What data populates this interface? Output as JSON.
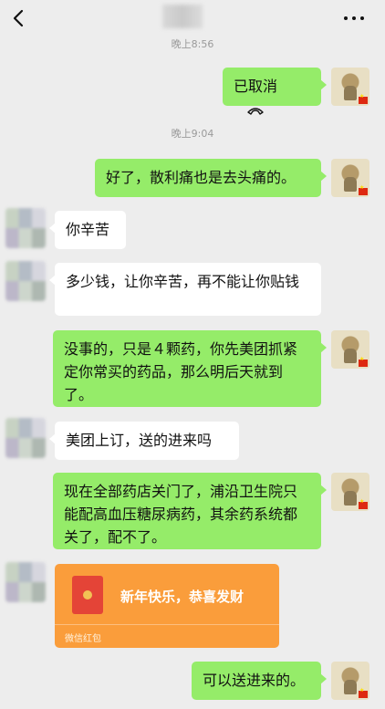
{
  "header": {
    "back_icon": "chevron-left-icon",
    "more_icon": "more-horizontal-icon"
  },
  "timestamps": {
    "first": "晚上8:56",
    "second": "晚上9:04"
  },
  "messages": [
    {
      "from": "me",
      "text": "已取消",
      "icon": "hangup-icon"
    },
    {
      "from": "me",
      "text": "好了，散利痛也是去头痛的。"
    },
    {
      "from": "other",
      "text": "你辛苦"
    },
    {
      "from": "other",
      "text": "多少钱，让你辛苦，再不能让你贴钱"
    },
    {
      "from": "me",
      "text": "没事的，只是４颗药，你先美团抓紧定你常买的药品，那么明后天就到了。"
    },
    {
      "from": "other",
      "text": "美团上订，送的进来吗"
    },
    {
      "from": "me",
      "text": "现在全部药店关门了，浦沿卫生院只能配高血压糖尿病药，其余药系统都关了，配不了。"
    },
    {
      "from": "other",
      "type": "red-packet",
      "title": "新年快乐，恭喜发财",
      "label": "微信红包"
    },
    {
      "from": "me",
      "text": "可以送进来的。"
    }
  ],
  "colors": {
    "background": "#ededed",
    "my_bubble": "#95ec69",
    "other_bubble": "#ffffff",
    "red_packet": "#fa9d3b"
  }
}
